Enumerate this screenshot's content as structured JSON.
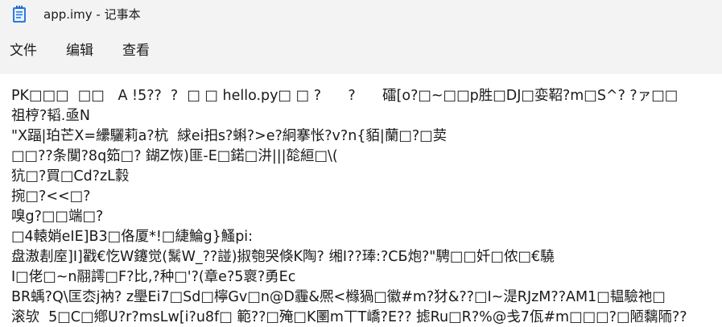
{
  "window": {
    "title": "app.imy - 记事本",
    "icon": "notepad-icon"
  },
  "menu": {
    "items": [
      "文件",
      "编辑",
      "查看"
    ]
  },
  "editor": {
    "lines": [
      "PK□□□  □□   A !5??  ?  □ □ hello.py□ □ ?      ?      礌[o?□~□□p胜□DJ□娈鞀?m□S^? ?ァ□□",
      "祖梈?韬.亟N",
      "\"X踾|珀芒X=纝驪莉a?杭  絿ei抇s?蝌?>e?絅搴怅?v?n{貊|蘭□?□荬",
      "□□??条闃?8q筎□? 鍸Z恢)匪-E□鍩□汫|||旕絙□\\(",
      "犺□?買□Cd?zL豰",
      "捥□?<<□?",
      "嗅g?□□端□?",
      "□4轅娋eIE]B3□佫厦*!□緁鯩g}鰠pi:",
      "盘滶剨庢]I]戳€忔W鑳觉(鬗W_??諩)掓匏哭倏K陶? 缃I??琫:?CБ炮?\"騁□□奷□侬□€驍",
      "I□佬□~n翮謣□F?比,?种□'?(章e?5褱?勇Ec",
      "BR蝺?Q\\匡枩j衲? z璺Ei7□Sd□檸Gv□n@D霾&熈<橼猧□徽#m?犲&??□I~湜RJzM??AM1□韫驗祂□",
      "滚欤  5□C□鄕U?r?msLw[i?u8f□ 範??□殗□K圛m丅T嶠?E?? 摅Ru□R?%@戋7佤#m□□□?□陋黐陑??"
    ]
  }
}
